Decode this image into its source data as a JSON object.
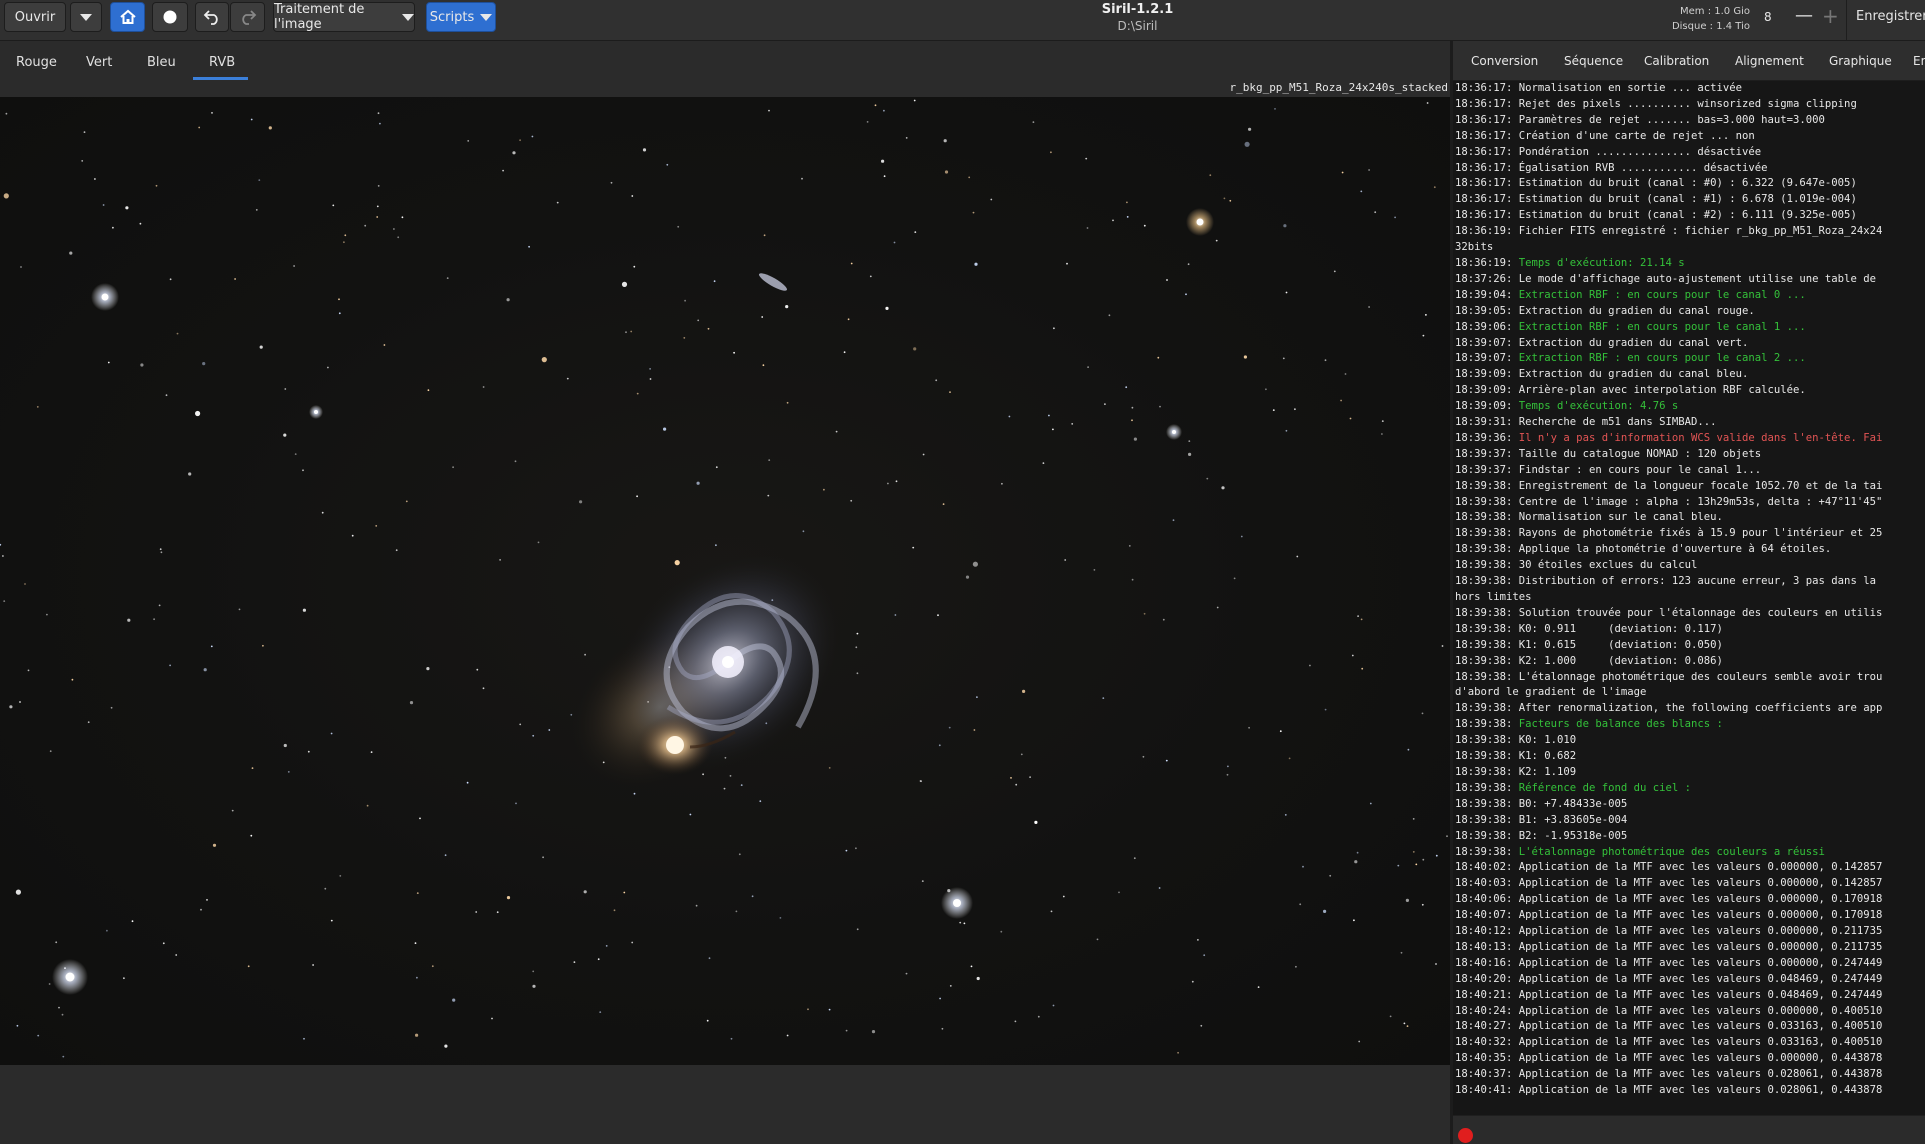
{
  "header": {
    "open_label": "Ouvrir",
    "processing_label": "Traitement de l'image",
    "scripts_label": "Scripts",
    "app_title": "Siril-1.2.1",
    "app_path": "D:\\Siril",
    "mem_label": "Mem : 1.0 Gio",
    "disk_label": "Disque : 1.4 Tio",
    "threads_value": "8",
    "minus_symbol": "—",
    "plus_symbol": "+",
    "save_label": "Enregistrer",
    "icons": [
      "dropdown-arrow-icon",
      "home-icon",
      "circle-icon",
      "undo-icon",
      "redo-icon"
    ],
    "accent_color": "#2e6fd1"
  },
  "channels": {
    "tabs": [
      "Rouge",
      "Vert",
      "Bleu",
      "RVB"
    ],
    "active": "RVB"
  },
  "image": {
    "filename": "r_bkg_pp_M51_Roza_24x240s_stacked"
  },
  "right_tabs": [
    "Conversion",
    "Séquence",
    "Calibration",
    "Alignement",
    "Graphique",
    "Em"
  ],
  "console": {
    "lines": [
      {
        "t": "18:36:17:",
        "m": " Normalisation en sortie ... activée",
        "c": "white"
      },
      {
        "t": "18:36:17:",
        "m": " Rejet des pixels .......... winsorized sigma clipping",
        "c": "white"
      },
      {
        "t": "18:36:17:",
        "m": " Paramètres de rejet ....... bas=3.000 haut=3.000",
        "c": "white"
      },
      {
        "t": "18:36:17:",
        "m": " Création d'une carte de rejet ... non",
        "c": "white"
      },
      {
        "t": "18:36:17:",
        "m": " Pondération ............... désactivée",
        "c": "white"
      },
      {
        "t": "18:36:17:",
        "m": " Égalisation RVB ............ désactivée",
        "c": "white"
      },
      {
        "t": "18:36:17:",
        "m": " Estimation du bruit (canal : #0) : 6.322 (9.647e-005)",
        "c": "white"
      },
      {
        "t": "18:36:17:",
        "m": " Estimation du bruit (canal : #1) : 6.678 (1.019e-004)",
        "c": "white"
      },
      {
        "t": "18:36:17:",
        "m": " Estimation du bruit (canal : #2) : 6.111 (9.325e-005)",
        "c": "white"
      },
      {
        "t": "18:36:19:",
        "m": " Fichier FITS enregistré : fichier r_bkg_pp_M51_Roza_24x24",
        "c": "white"
      },
      {
        "t": "",
        "m": "32bits",
        "c": "white"
      },
      {
        "t": "18:36:19:",
        "m": " Temps d'exécution: 21.14 s",
        "c": "green"
      },
      {
        "t": "18:37:26:",
        "m": " Le mode d'affichage auto-ajustement utilise une table de",
        "c": "white"
      },
      {
        "t": "18:39:04:",
        "m": " Extraction RBF : en cours pour le canal 0 ...",
        "c": "green"
      },
      {
        "t": "18:39:05:",
        "m": " Extraction du gradien du canal rouge.",
        "c": "white"
      },
      {
        "t": "18:39:06:",
        "m": " Extraction RBF : en cours pour le canal 1 ...",
        "c": "green"
      },
      {
        "t": "18:39:07:",
        "m": " Extraction du gradien du canal vert.",
        "c": "white"
      },
      {
        "t": "18:39:07:",
        "m": " Extraction RBF : en cours pour le canal 2 ...",
        "c": "green"
      },
      {
        "t": "18:39:09:",
        "m": " Extraction du gradien du canal bleu.",
        "c": "white"
      },
      {
        "t": "18:39:09:",
        "m": " Arrière-plan avec interpolation RBF calculée.",
        "c": "white"
      },
      {
        "t": "18:39:09:",
        "m": " Temps d'exécution: 4.76 s",
        "c": "green"
      },
      {
        "t": "18:39:31:",
        "m": " Recherche de m51 dans SIMBAD...",
        "c": "white"
      },
      {
        "t": "18:39:36:",
        "m": " Il n'y a pas d'information WCS valide dans l'en-tête. Fai",
        "c": "red"
      },
      {
        "t": "18:39:37:",
        "m": " Taille du catalogue NOMAD : 120 objets",
        "c": "white"
      },
      {
        "t": "18:39:37:",
        "m": " Findstar : en cours pour le canal 1...",
        "c": "white"
      },
      {
        "t": "18:39:38:",
        "m": " Enregistrement de la longueur focale 1052.70 et de la tai",
        "c": "white"
      },
      {
        "t": "18:39:38:",
        "m": " Centre de l'image : alpha : 13h29m53s, delta : +47°11'45\"",
        "c": "white"
      },
      {
        "t": "18:39:38:",
        "m": " Normalisation sur le canal bleu.",
        "c": "white"
      },
      {
        "t": "18:39:38:",
        "m": " Rayons de photométrie fixés à 15.9 pour l'intérieur et 25",
        "c": "white"
      },
      {
        "t": "18:39:38:",
        "m": " Applique la photométrie d'ouverture à 64 étoiles.",
        "c": "white"
      },
      {
        "t": "18:39:38:",
        "m": " 30 étoiles exclues du calcul",
        "c": "white"
      },
      {
        "t": "18:39:38:",
        "m": " Distribution of errors: 123 aucune erreur, 3 pas dans la",
        "c": "white"
      },
      {
        "t": "",
        "m": "hors limites",
        "c": "white"
      },
      {
        "t": "18:39:38:",
        "m": " Solution trouvée pour l'étalonnage des couleurs en utilis",
        "c": "white"
      },
      {
        "t": "18:39:38:",
        "m": " K0: 0.911     (deviation: 0.117)",
        "c": "white"
      },
      {
        "t": "18:39:38:",
        "m": " K1: 0.615     (deviation: 0.050)",
        "c": "white"
      },
      {
        "t": "18:39:38:",
        "m": " K2: 1.000     (deviation: 0.086)",
        "c": "white"
      },
      {
        "t": "18:39:38:",
        "m": " L'étalonnage photométrique des couleurs semble avoir trou",
        "c": "white"
      },
      {
        "t": "",
        "m": "d'abord le gradient de l'image",
        "c": "white"
      },
      {
        "t": "18:39:38:",
        "m": " After renormalization, the following coefficients are app",
        "c": "white"
      },
      {
        "t": "18:39:38:",
        "m": " Facteurs de balance des blancs :",
        "c": "green"
      },
      {
        "t": "18:39:38:",
        "m": " K0: 1.010",
        "c": "white"
      },
      {
        "t": "18:39:38:",
        "m": " K1: 0.682",
        "c": "white"
      },
      {
        "t": "18:39:38:",
        "m": " K2: 1.109",
        "c": "white"
      },
      {
        "t": "18:39:38:",
        "m": " Référence de fond du ciel :",
        "c": "green"
      },
      {
        "t": "18:39:38:",
        "m": " B0: +7.48433e-005",
        "c": "white"
      },
      {
        "t": "18:39:38:",
        "m": " B1: +3.83605e-004",
        "c": "white"
      },
      {
        "t": "18:39:38:",
        "m": " B2: -1.95318e-005",
        "c": "white"
      },
      {
        "t": "18:39:38:",
        "m": " L'étalonnage photométrique des couleurs a réussi",
        "c": "green"
      },
      {
        "t": "18:40:02:",
        "m": " Application de la MTF avec les valeurs 0.000000, 0.142857",
        "c": "white"
      },
      {
        "t": "18:40:03:",
        "m": " Application de la MTF avec les valeurs 0.000000, 0.142857",
        "c": "white"
      },
      {
        "t": "18:40:06:",
        "m": " Application de la MTF avec les valeurs 0.000000, 0.170918",
        "c": "white"
      },
      {
        "t": "18:40:07:",
        "m": " Application de la MTF avec les valeurs 0.000000, 0.170918",
        "c": "white"
      },
      {
        "t": "18:40:12:",
        "m": " Application de la MTF avec les valeurs 0.000000, 0.211735",
        "c": "white"
      },
      {
        "t": "18:40:13:",
        "m": " Application de la MTF avec les valeurs 0.000000, 0.211735",
        "c": "white"
      },
      {
        "t": "18:40:16:",
        "m": " Application de la MTF avec les valeurs 0.000000, 0.247449",
        "c": "white"
      },
      {
        "t": "18:40:20:",
        "m": " Application de la MTF avec les valeurs 0.048469, 0.247449",
        "c": "white"
      },
      {
        "t": "18:40:21:",
        "m": " Application de la MTF avec les valeurs 0.048469, 0.247449",
        "c": "white"
      },
      {
        "t": "18:40:24:",
        "m": " Application de la MTF avec les valeurs 0.000000, 0.400510",
        "c": "white"
      },
      {
        "t": "18:40:27:",
        "m": " Application de la MTF avec les valeurs 0.033163, 0.400510",
        "c": "white"
      },
      {
        "t": "18:40:32:",
        "m": " Application de la MTF avec les valeurs 0.033163, 0.400510",
        "c": "white"
      },
      {
        "t": "18:40:35:",
        "m": " Application de la MTF avec les valeurs 0.000000, 0.443878",
        "c": "white"
      },
      {
        "t": "18:40:37:",
        "m": " Application de la MTF avec les valeurs 0.028061, 0.443878",
        "c": "white"
      },
      {
        "t": "18:40:41:",
        "m": " Application de la MTF avec les valeurs 0.028061, 0.443878",
        "c": "white"
      }
    ]
  },
  "colors": {
    "log_green": "#34c13a",
    "log_red": "#e25454",
    "stop_indicator": "#e01e1e"
  }
}
